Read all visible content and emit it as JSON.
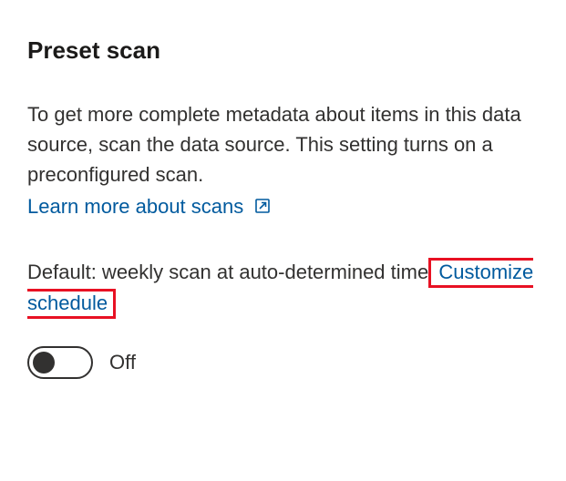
{
  "heading": "Preset scan",
  "description": "To get more complete metadata about items in this data source, scan the data source. This setting turns on a preconfigured scan.",
  "learn_more_label": "Learn more about scans",
  "default_prefix": "Default: weekly scan at auto-determined time",
  "customize_label": "Customize schedule",
  "toggle": {
    "state_label": "Off",
    "on": false
  }
}
